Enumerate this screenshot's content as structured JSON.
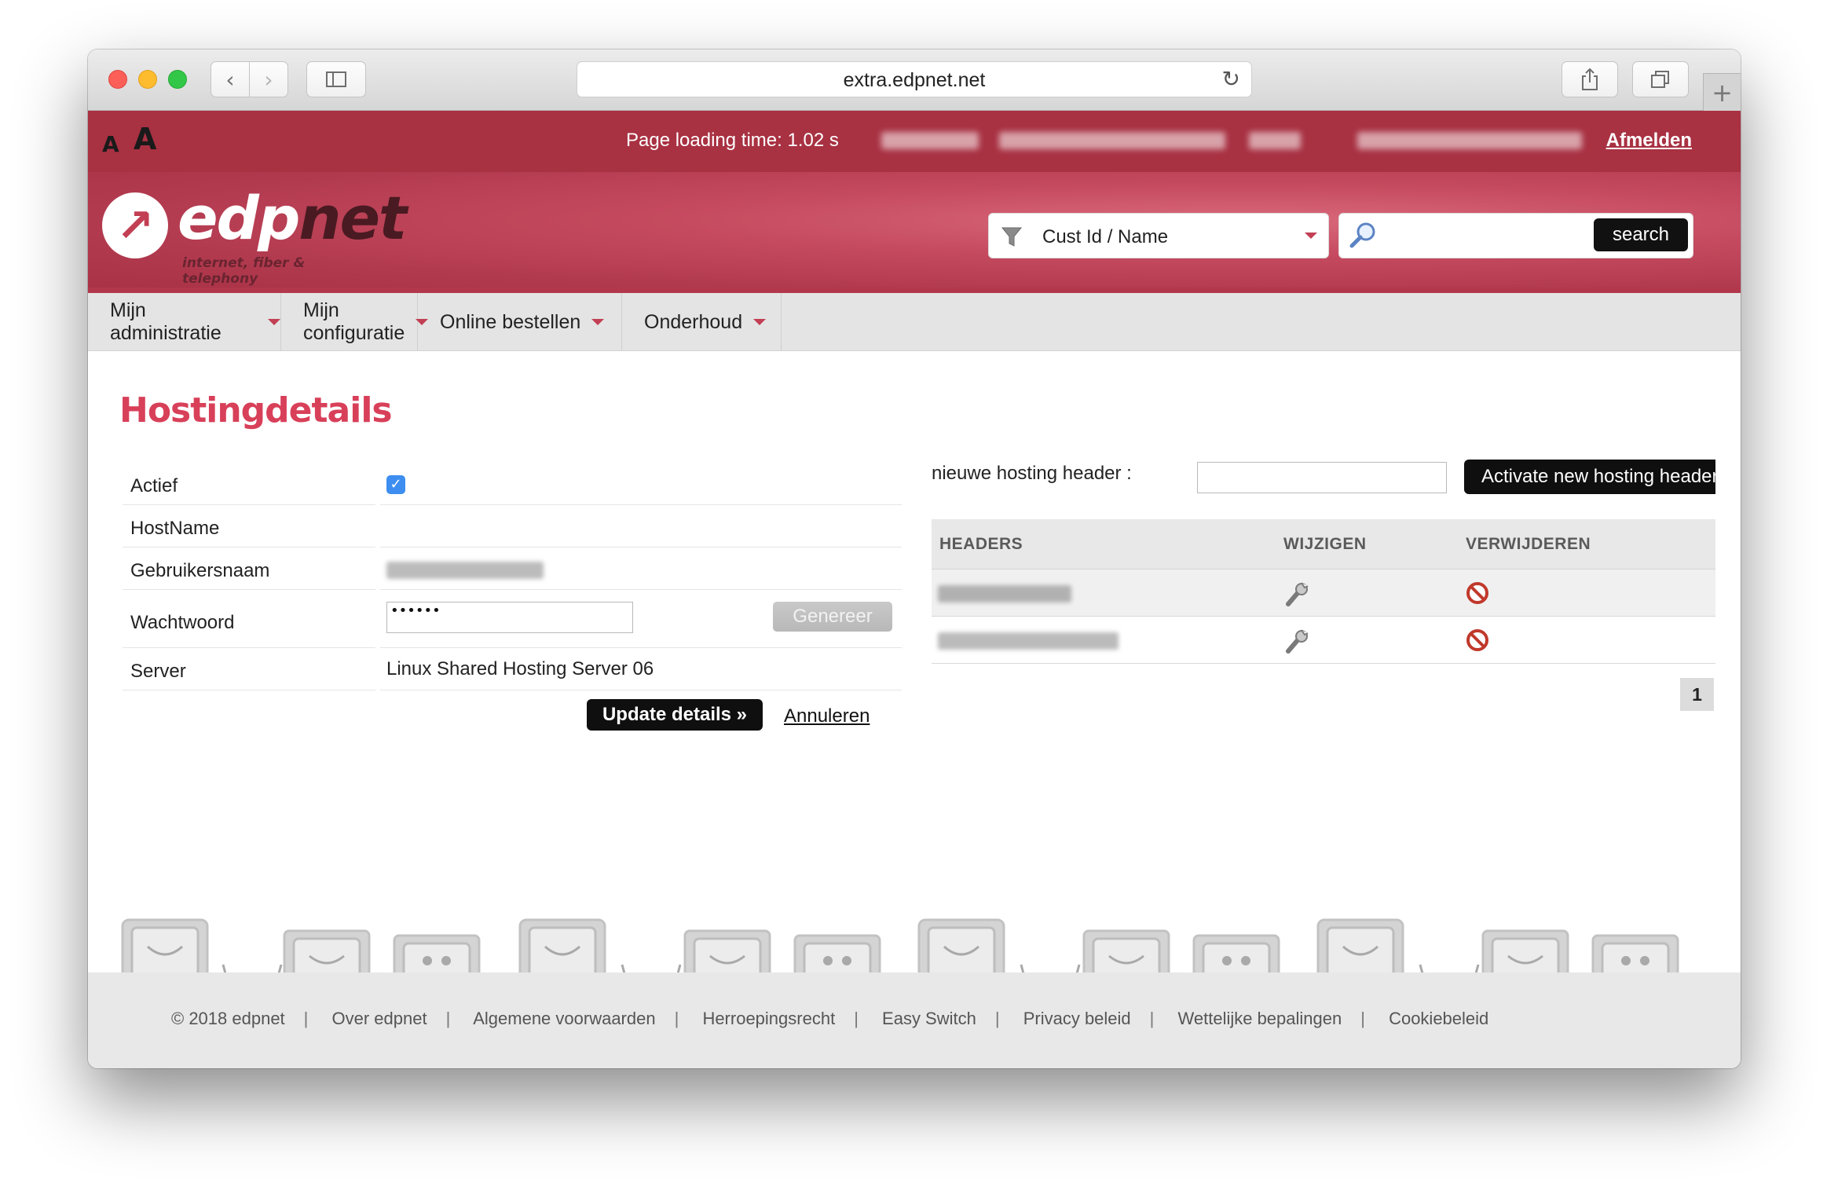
{
  "browser": {
    "url": "extra.edpnet.net",
    "back_icon": "‹",
    "forward_icon": "›",
    "reload_icon": "↻",
    "plus_icon": "+"
  },
  "topbar": {
    "font_small": "A",
    "font_large": "A",
    "load_time": "Page loading time: 1.02 s",
    "logout": "Afmelden"
  },
  "brand": {
    "name_part1": "edp",
    "name_part2": "net",
    "tagline": "internet, fiber & telephony",
    "accent": "#c23f54"
  },
  "search": {
    "filter_label": "Cust Id / Name",
    "button": "search"
  },
  "nav": {
    "items": [
      {
        "label": "Mijn administratie"
      },
      {
        "label": "Mijn configuratie"
      },
      {
        "label": "Online bestellen"
      },
      {
        "label": "Onderhoud"
      }
    ]
  },
  "page": {
    "title": "Hostingdetails"
  },
  "form": {
    "actief_label": "Actief",
    "actief_checked": true,
    "hostname_label": "HostName",
    "username_label": "Gebruikersnaam",
    "password_label": "Wachtwoord",
    "password_value": "••••••",
    "generate_button": "Genereer",
    "server_label": "Server",
    "server_value": "Linux Shared Hosting Server 06",
    "update_button": "Update details »",
    "cancel_link": "Annuleren"
  },
  "headers_panel": {
    "new_header_label": "nieuwe hosting header :",
    "activate_button": "Activate new hosting header",
    "columns": [
      "HEADERS",
      "WIJZIGEN",
      "VERWIJDEREN"
    ],
    "row_count": 2,
    "page_number": "1"
  },
  "footer": {
    "links": [
      "© 2018 edpnet",
      "Over edpnet",
      "Algemene voorwaarden",
      "Herroepingsrecht",
      "Easy Switch",
      "Privacy beleid",
      "Wettelijke bepalingen",
      "Cookiebeleid"
    ],
    "separator": "|"
  }
}
